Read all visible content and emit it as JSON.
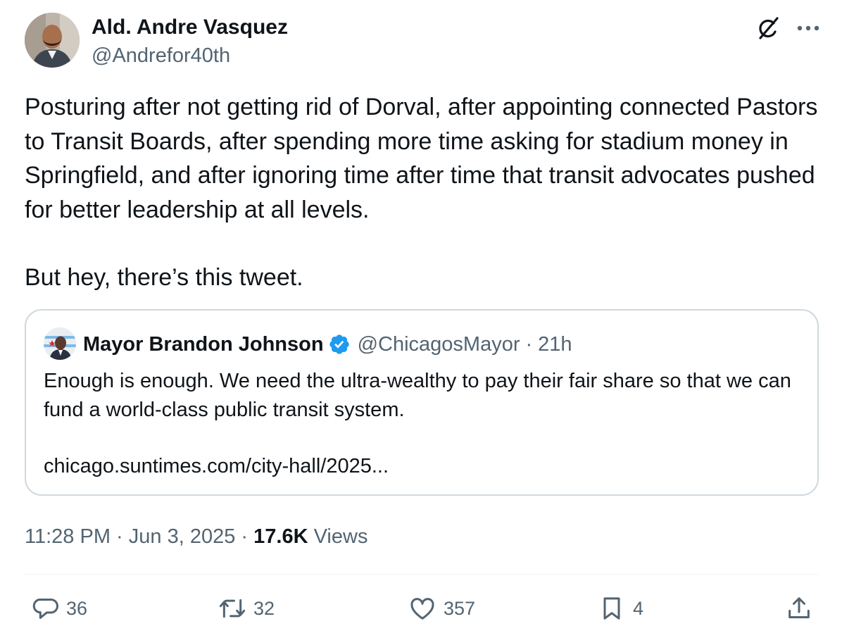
{
  "author": {
    "name": "Ald. Andre Vasquez",
    "handle": "@Andrefor40th"
  },
  "tweet": {
    "paragraph1": "Posturing after not getting rid of Dorval, after appointing connected Pastors to Transit Boards, after spending more time asking for stadium money in Springfield, and after ignoring time after time that transit advocates pushed for better leadership at all levels.",
    "paragraph2": "But hey, there’s this tweet."
  },
  "quoted": {
    "name": "Mayor Brandon Johnson",
    "handle": "@ChicagosMayor",
    "separator": "·",
    "time": "21h",
    "text": "Enough is enough. We need the ultra-wealthy to pay their fair share so that we can fund a world-class public transit system.",
    "link": "chicago.suntimes.com/city-hall/2025..."
  },
  "meta": {
    "time": "11:28 PM",
    "separator": "·",
    "date": "Jun 3, 2025",
    "views_count": "17.6K",
    "views_label": "Views"
  },
  "actions": {
    "replies": "36",
    "retweets": "32",
    "likes": "357",
    "bookmarks": "4"
  },
  "icons": {
    "header": [
      "grok-icon",
      "more-icon"
    ],
    "actions": [
      "reply-icon",
      "retweet-icon",
      "like-icon",
      "bookmark-icon",
      "share-icon"
    ],
    "verified": "verified-badge-icon"
  },
  "colors": {
    "text_primary": "#0f1419",
    "text_secondary": "#536471",
    "border": "#cfd9de",
    "verified": "#1d9bf0"
  }
}
